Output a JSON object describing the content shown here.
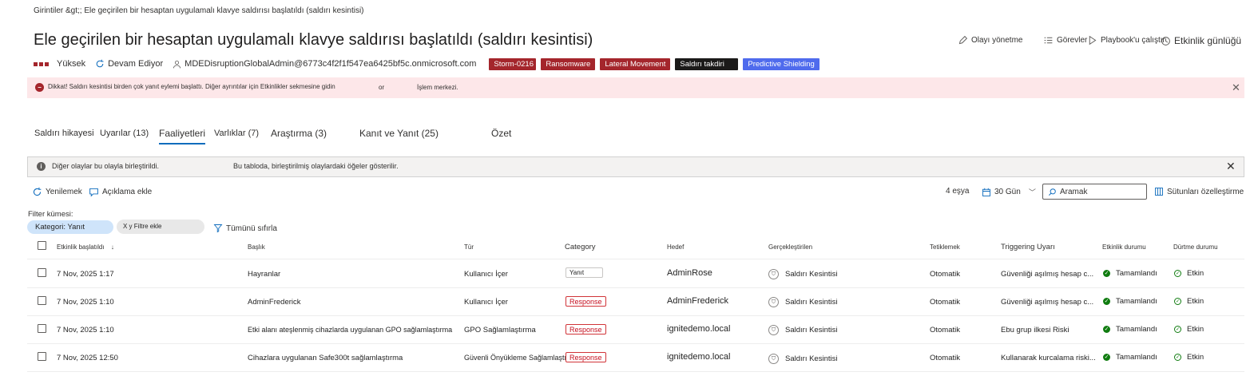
{
  "breadcrumb": "Girintiler &gt;;   Ele geçirilen bir hesaptan uygulamalı klavye saldırısı başlatıldı (saldırı kesintisi)",
  "title": "Ele geçirilen bir hesaptan uygulamalı klavye saldırısı başlatıldı (saldırı kesintisi)",
  "header_actions": {
    "manage": "Olayı yönetme",
    "tasks": "Görevler",
    "playbook": "Playbook'u çalıştır",
    "activity_log": "Etkinlik günlüğü"
  },
  "meta": {
    "severity": "Yüksek",
    "status": "Devam Ediyor",
    "user": "MDEDisruptionGlobalAdmin@6773c4f2f1f547ea6425bf5c.onmicrosoft.com"
  },
  "tags": [
    "Storm-0216",
    "Ransomware",
    "Lateral Movement",
    "Saldırı takdiri",
    "Predictive Shielding"
  ],
  "warning": {
    "text": "Dikkat! Saldırı kesintisi birden çok yanıt eylemi başlattı. Diğer ayrıntılar için Etkinlikler sekmesine gidin",
    "extra": "or",
    "link": "İşlem merkezi."
  },
  "tabs": [
    "Saldırı hikayesi",
    "Uyarılar (13)",
    "Faaliyetleri",
    "Varlıklar (7)",
    "Araştırma (3)",
    "Kanıt ve Yanıt (25)",
    "Özet"
  ],
  "info": {
    "text1": "Diğer olaylar bu olayla birleştirildi.",
    "text2": "Bu tabloda, birleştirilmiş olaylardaki öğeler gösterilir."
  },
  "commands": {
    "refresh": "Yenilemek",
    "add_comment": "Açıklama ekle",
    "count": "4 eşya",
    "days": "30 Gün",
    "search_placeholder": "Aramak",
    "customize": "Sütunları özelleştirme"
  },
  "filters": {
    "label": "Filter kümesi:",
    "chip": "Kategori: Yanıt",
    "add": "X y Filtre ekle",
    "reset": "Tümünü sıfırla"
  },
  "columns": [
    "Etkinlik başlatıldı",
    "Başlık",
    "Tür",
    "Category",
    "Hedef",
    "Gerçekleştirilen",
    "Tetiklemek",
    "Triggering Uyarı",
    "Etkinlik durumu",
    "Dürtme durumu"
  ],
  "rows": [
    {
      "date": "7 Nov, 2025 1:17",
      "title": "Hayranlar",
      "type": "Kullanıcı İçer",
      "category": "Yanıt",
      "target": "AdminRose",
      "actor": "Saldırı Kesintisi",
      "trigger": "Otomatik",
      "alert": "Güvenliği aşılmış hesap c...",
      "status": "Tamamlandı",
      "nudge": "Etkin"
    },
    {
      "date": "7 Nov, 2025 1:10",
      "title": "AdminFrederick",
      "type": "Kullanıcı İçer",
      "category": "Response",
      "target": "AdminFrederick",
      "actor": "Saldırı Kesintisi",
      "trigger": "Otomatik",
      "alert": "Güvenliği aşılmış hesap c...",
      "status": "Tamamlandı",
      "nudge": "Etkin"
    },
    {
      "date": "7 Nov, 2025 1:10",
      "title": "Etki alanı ateşlenmiş cihazlarda uygulanan GPO sağlamlaştırma",
      "type": "GPO Sağlamlaştırma",
      "category": "Response",
      "target": "ignitedemo.local",
      "actor": "Saldırı Kesintisi",
      "trigger": "Otomatik",
      "alert": "Ebu grup ilkesi Riski",
      "status": "Tamamlandı",
      "nudge": "Etkin"
    },
    {
      "date": "7 Nov, 2025 12:50",
      "title": "Cihazlara uygulanan Safe300t sağlamlaştırma",
      "type": "Güvenli Önyükleme Sağlamlaştırma",
      "category": "Response",
      "target": "ignitedemo.local",
      "actor": "Saldırı Kesintisi",
      "trigger": "Otomatik",
      "alert": "Kullanarak kurcalama riski...",
      "status": "Tamamlandı",
      "nudge": "Etkin"
    }
  ]
}
